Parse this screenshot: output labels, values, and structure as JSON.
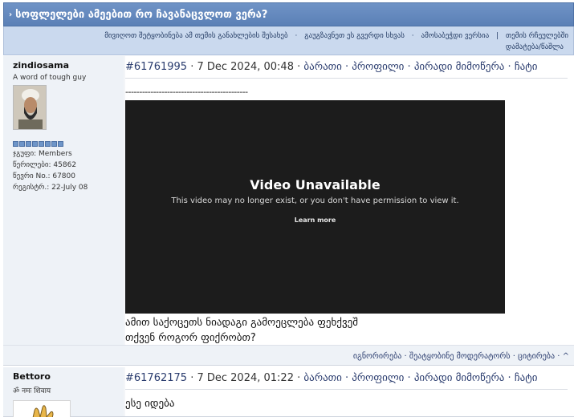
{
  "topic": {
    "title": "სოფლელები ამეებით რო ჩავანაცვლოთ ვერა?"
  },
  "topic_actions": {
    "send_to_friend": "მივიღოთ შეტყობინება ამ თემის განახლების შესახებ",
    "share": "გაუგზავნეთ ეს გვერდი სხვას",
    "print": "ამოსაბეჭდი ვერსია",
    "options": "თემის რჩეულებში",
    "add_delete": "დამატება/წაშლა"
  },
  "posts": [
    {
      "username": "zindiosama",
      "user_title": "A word of tough guy",
      "stars": 8,
      "group": "ჯგუფი: Members",
      "posts": "წერილები: 45862",
      "member_no": "წევრი No.: 67800",
      "registered": "რეგისტრ.: 22-July 08",
      "id": "#61761995",
      "date": "· 7 Dec 2024, 00:48 ·",
      "links": {
        "card": "ბარათი",
        "profile": "პროფილი",
        "pm": "პირადი მიმოწერა",
        "chat": "ჩატი"
      },
      "separator_line": "--------------------------------------------",
      "video": {
        "title": "Video Unavailable",
        "text": "This video may no longer exist, or you don't have permission to view it.",
        "link": "Learn more"
      },
      "text_line1": "ამით საქოცეთს ნიადაგი გამოეცლება ფეხქვეშ",
      "text_line2": "თქვენ როგორ ფიქრობთ?",
      "footer": {
        "ignore": "იგნორირება",
        "report": "შეატყობინე მოდერატორს",
        "quote": "ციტირება",
        "top": "^"
      }
    },
    {
      "username": "Bettoro",
      "user_title": "ॐ नमः शिवाय",
      "id": "#61762175",
      "date": "· 7 Dec 2024, 01:22 ·",
      "links": {
        "card": "ბარათი",
        "profile": "პროფილი",
        "pm": "პირადი მიმოწერა",
        "chat": "ჩატი"
      },
      "text_line1": "ესე იდება"
    }
  ],
  "colors": {
    "header": "#5b80b6",
    "actions_bg": "#cad9ee",
    "link": "#2b3d6f"
  }
}
